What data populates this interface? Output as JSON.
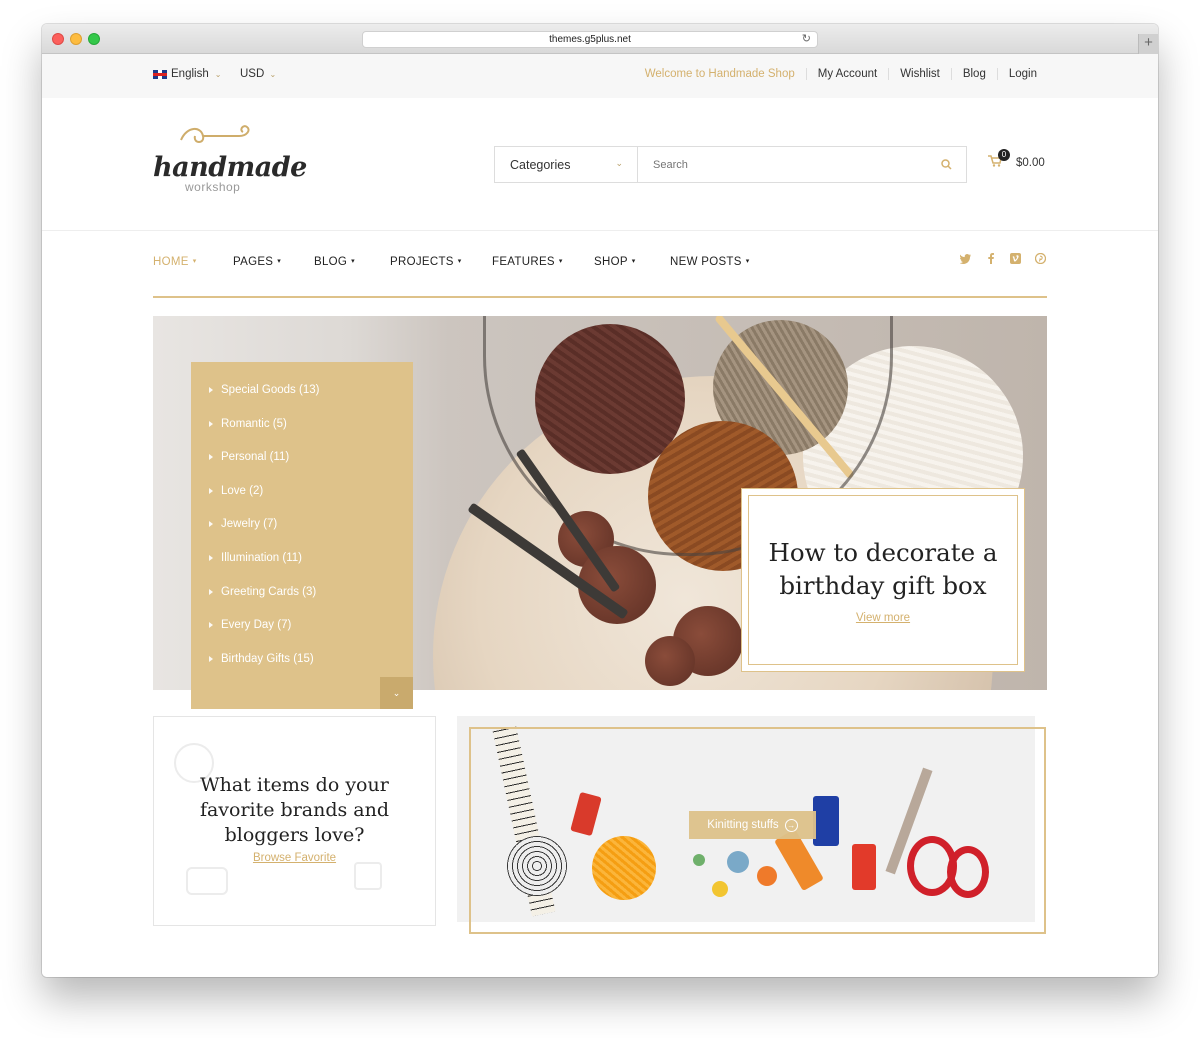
{
  "browser": {
    "url": "themes.g5plus.net"
  },
  "topbar": {
    "language": "English",
    "currency": "USD",
    "links": [
      "Welcome to Handmade Shop",
      "My Account",
      "Wishlist",
      "Blog",
      "Login"
    ]
  },
  "header": {
    "logo_main": "handmade",
    "logo_sub": "workshop",
    "search_category": "Categories",
    "search_placeholder": "Search",
    "cart_count": "0",
    "cart_total": "$0.00"
  },
  "nav": {
    "items": [
      "HOME",
      "PAGES",
      "BLOG",
      "PROJECTS",
      "FEATURES",
      "SHOP",
      "NEW POSTS"
    ],
    "active": "HOME",
    "social": [
      "twitter-icon",
      "facebook-icon",
      "vimeo-icon",
      "pinterest-icon"
    ]
  },
  "categories": [
    "Special Goods (13)",
    "Romantic (5)",
    "Personal (11)",
    "Love (2)",
    "Jewelry (7)",
    "Illumination (11)",
    "Greeting Cards (3)",
    "Every Day (7)",
    "Birthday Gifts (15)"
  ],
  "hero": {
    "title": "How to decorate a birthday gift box",
    "link": "View more"
  },
  "promo": {
    "title": "What items do your favorite brands and bloggers love?",
    "link": "Browse Favorite"
  },
  "knitting": {
    "label": "Kinitting stuffs"
  },
  "colors": {
    "accent": "#dec28a",
    "accent_text": "#d4b16e",
    "topbar_bg": "#f7f7f7"
  }
}
